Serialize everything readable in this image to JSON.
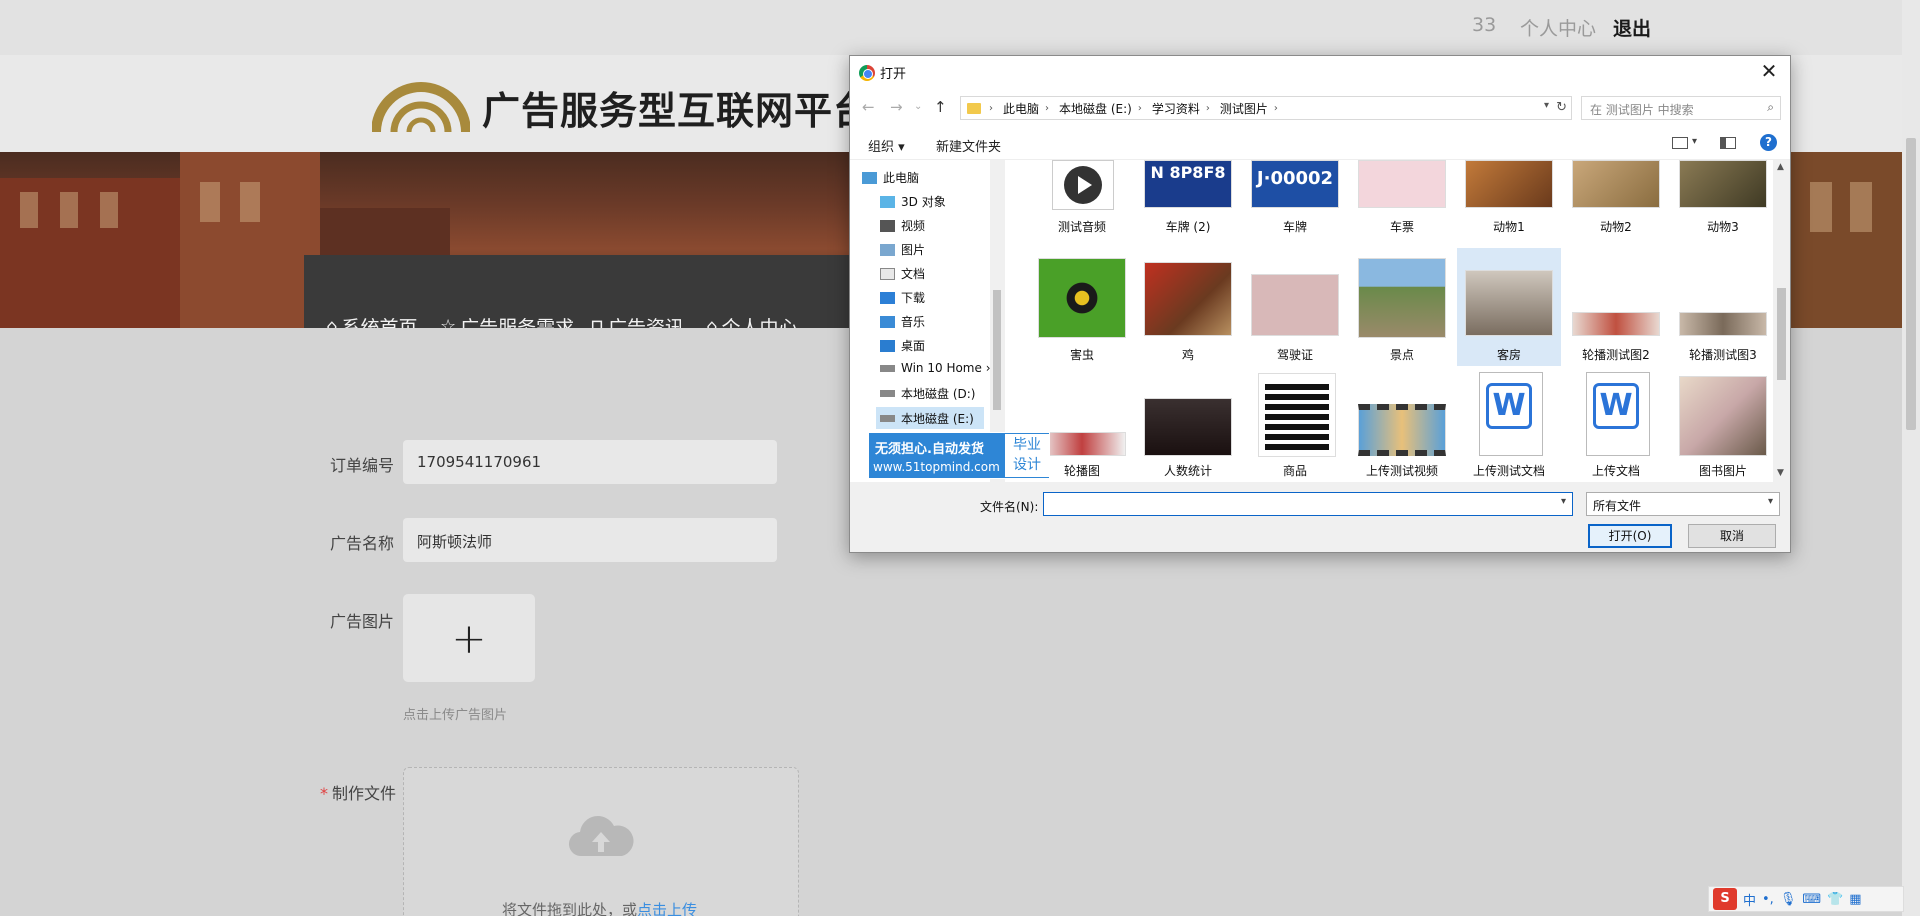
{
  "topbar": {
    "count": "33",
    "personal_center": "个人中心",
    "logout": "退出"
  },
  "header": {
    "title": "广告服务型互联网平台"
  },
  "nav": [
    {
      "icon": "⌂",
      "label": "系统首页"
    },
    {
      "icon": "☆",
      "label": "广告服务需求"
    },
    {
      "icon": "⊓",
      "label": "广告资讯"
    },
    {
      "icon": "⌂",
      "label": "个人中心"
    }
  ],
  "form": {
    "order_label": "订单编号",
    "order_value": "1709541170961",
    "name_label": "广告名称",
    "name_value": "阿斯顿法师",
    "image_label": "广告图片",
    "image_hint": "点击上传广告图片",
    "file_label": "制作文件",
    "file_required": "*",
    "drop_text": "将文件拖到此处，或",
    "drop_link": "点击上传"
  },
  "dialog": {
    "title": "打开",
    "close": "✕",
    "breadcrumbs": [
      "此电脑",
      "本地磁盘 (E:)",
      "学习资料",
      "测试图片"
    ],
    "search_placeholder": "在 测试图片 中搜索",
    "organize": "组织 ▾",
    "new_folder": "新建文件夹",
    "tree": [
      {
        "label": "此电脑",
        "icon": "pc-icon"
      },
      {
        "label": "3D 对象",
        "icon": "cube-icon"
      },
      {
        "label": "视频",
        "icon": "video-icon"
      },
      {
        "label": "图片",
        "icon": "picture-icon"
      },
      {
        "label": "文档",
        "icon": "document-icon"
      },
      {
        "label": "下载",
        "icon": "download-icon"
      },
      {
        "label": "音乐",
        "icon": "music-icon"
      },
      {
        "label": "桌面",
        "icon": "desktop-icon"
      },
      {
        "label": "Win 10 Home ›",
        "icon": "drive-icon"
      },
      {
        "label": "本地磁盘 (D:)",
        "icon": "drive-icon"
      },
      {
        "label": "本地磁盘 (E:)",
        "icon": "drive-icon"
      }
    ],
    "files": [
      {
        "label": "测试音频"
      },
      {
        "label": "车牌 (2)"
      },
      {
        "label": "车牌"
      },
      {
        "label": "车票"
      },
      {
        "label": "动物1"
      },
      {
        "label": "动物2"
      },
      {
        "label": "动物3"
      },
      {
        "label": "害虫"
      },
      {
        "label": "鸡"
      },
      {
        "label": "驾驶证"
      },
      {
        "label": "景点"
      },
      {
        "label": "客房"
      },
      {
        "label": "轮播测试图2"
      },
      {
        "label": "轮播测试图3"
      },
      {
        "label": "轮播图"
      },
      {
        "label": "人数统计"
      },
      {
        "label": "商品"
      },
      {
        "label": "上传测试视频"
      },
      {
        "label": "上传测试文档"
      },
      {
        "label": "上传文档"
      },
      {
        "label": "图书图片"
      }
    ],
    "plate1": "N 8P8F8",
    "plate2": "J·00002",
    "filename_label": "文件名(N):",
    "filetype": "所有文件",
    "open_button": "打开(O)",
    "cancel_button": "取消"
  },
  "watermark": {
    "line1": "无须担心.自动发货",
    "line2": "www.51topmind.com",
    "box_line1": "毕业",
    "box_line2": "设计"
  },
  "ime": {
    "logo": "S",
    "lang": "中",
    "punct": "•,"
  }
}
